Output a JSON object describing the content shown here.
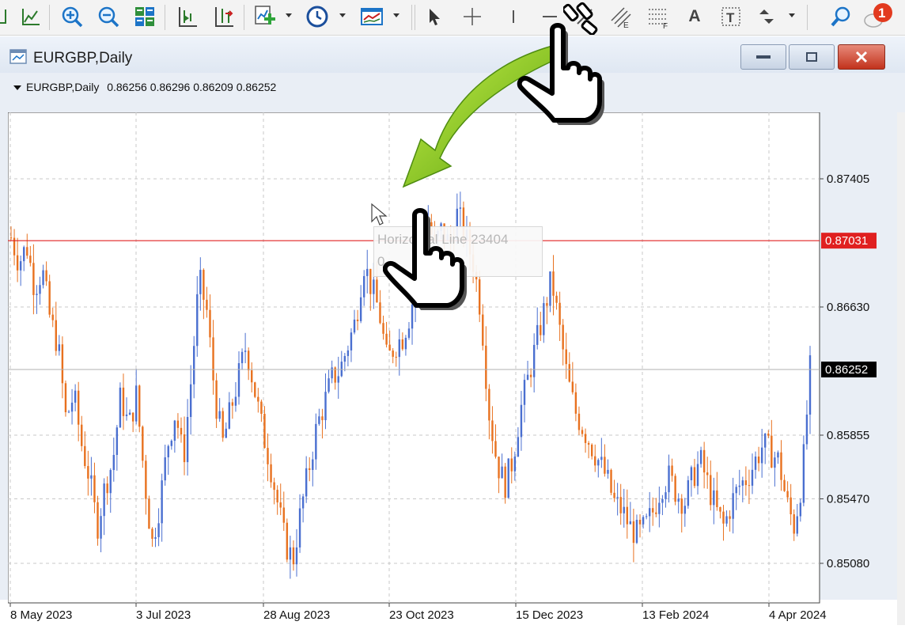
{
  "toolbar": {
    "items": [
      "line-chart-icon",
      "zoom-in-icon",
      "zoom-out-icon",
      "tile-windows-icon",
      "chart-shift-icon",
      "autoscroll-icon",
      "new-indicator-icon",
      "periods-clock-icon",
      "templates-icon",
      "cursor-icon",
      "crosshair-icon",
      "vertical-line-icon",
      "horizontal-line-icon",
      "trendline-icon",
      "equidistant-channel-icon",
      "fibonacci-icon",
      "text-icon",
      "text-label-icon",
      "arrows-icon",
      "search-icon",
      "notifications-icon"
    ],
    "notification_count": "1",
    "text_tool_label": "A",
    "text_label_tool_label": "T",
    "equidistant_suffix": "E",
    "fibonacci_suffix": "F"
  },
  "window": {
    "title": "EURGBP,Daily",
    "minimize": "minimize",
    "maximize": "maximize",
    "close": "close"
  },
  "chart_header": {
    "symbol": "EURGBP,Daily",
    "ohlc": "0.86256 0.86296 0.86209 0.86252"
  },
  "colors": {
    "bull": "#4a6fd0",
    "bear": "#e8711f",
    "hline": "#e02020",
    "grid": "#c8c8c8",
    "arrow_green": "#7ac614"
  },
  "tooltip": {
    "line1": "Horizontal Line 23404",
    "line2": "0."
  },
  "chart_data": {
    "type": "candlestick",
    "title": "EURGBP,Daily",
    "y_ticks": [
      "0.87405",
      "0.86630",
      "0.85855",
      "0.85470",
      "0.85080"
    ],
    "x_ticks": [
      "8 May 2023",
      "3 Jul 2023",
      "28 Aug 2023",
      "23 Oct 2023",
      "15 Dec 2023",
      "13 Feb 2024",
      "4 Apr 2024"
    ],
    "horizontal_line": {
      "name": "Horizontal Line 23404",
      "value": 0.87031,
      "label": "0.87031"
    },
    "current_price": {
      "value": 0.86252,
      "label": "0.86252"
    },
    "ylim": [
      0.8485,
      0.8765
    ],
    "close_path": [
      0.8705,
      0.869,
      0.87,
      0.8675,
      0.8685,
      0.8655,
      0.864,
      0.8595,
      0.861,
      0.858,
      0.856,
      0.853,
      0.8555,
      0.857,
      0.861,
      0.859,
      0.861,
      0.856,
      0.852,
      0.8545,
      0.858,
      0.86,
      0.857,
      0.862,
      0.868,
      0.866,
      0.861,
      0.858,
      0.86,
      0.862,
      0.864,
      0.8615,
      0.859,
      0.857,
      0.8545,
      0.852,
      0.851,
      0.854,
      0.8565,
      0.859,
      0.8605,
      0.862,
      0.8625,
      0.864,
      0.8655,
      0.869,
      0.8675,
      0.866,
      0.863,
      0.864,
      0.8645,
      0.866,
      0.869,
      0.872,
      0.87,
      0.871,
      0.87,
      0.872,
      0.8705,
      0.869,
      0.866,
      0.86,
      0.857,
      0.8555,
      0.857,
      0.86,
      0.862,
      0.864,
      0.866,
      0.868,
      0.865,
      0.862,
      0.86,
      0.859,
      0.858,
      0.857,
      0.856,
      0.8545,
      0.854,
      0.853,
      0.8525,
      0.853,
      0.854,
      0.8555,
      0.856,
      0.855,
      0.8545,
      0.856,
      0.857,
      0.8555,
      0.854,
      0.853,
      0.8545,
      0.8555,
      0.856,
      0.857,
      0.858,
      0.8575,
      0.857,
      0.8545,
      0.853,
      0.856,
      0.8625
    ]
  }
}
